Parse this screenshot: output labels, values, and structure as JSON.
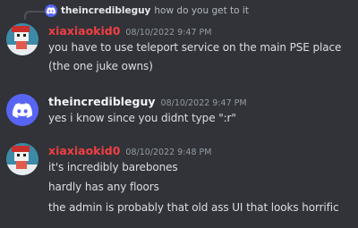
{
  "reply": {
    "username": "theincredibleguy",
    "text": "how do you get to it"
  },
  "messages": [
    {
      "username": "xiaxiaokid0",
      "timestamp": "08/10/2022 9:47 PM",
      "lines": [
        "you have to use teleport service on the main PSE place",
        "(the one juke owns)"
      ]
    },
    {
      "username": "theincredibleguy",
      "timestamp": "08/10/2022 9:47 PM",
      "lines": [
        "yes i know since you didnt type \":r\""
      ]
    },
    {
      "username": "xiaxiaokid0",
      "timestamp": "08/10/2022 9:48 PM",
      "lines": [
        "it's incredibly barebones",
        "hardly has any floors",
        "the admin is probably that old ass UI that looks horrific"
      ]
    }
  ],
  "colors": {
    "background": "#313338",
    "username_red": "#f23f43",
    "discord_blurple": "#5865f2"
  }
}
